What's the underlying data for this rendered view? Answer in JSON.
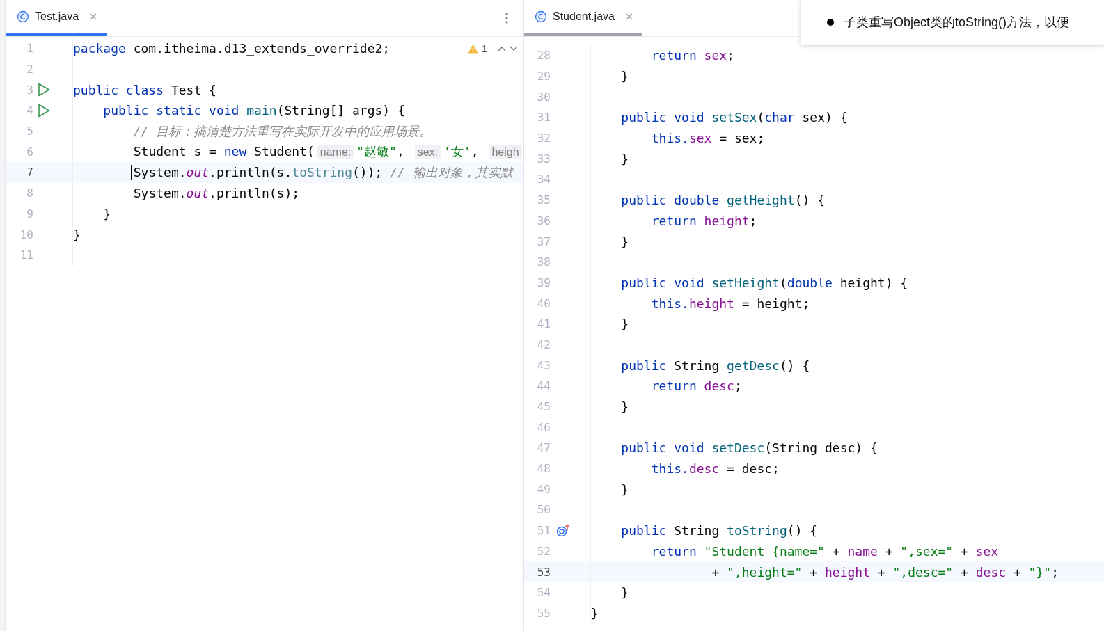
{
  "left_editor": {
    "focused": true,
    "tab": {
      "title": "Test.java",
      "selected": true
    },
    "problems": {
      "count": "1"
    },
    "lines": [
      {
        "number": "1",
        "current": false,
        "kind": "plain",
        "tokens": [
          {
            "kind": "kw",
            "text": "package"
          },
          {
            "kind": "id",
            "text": " com.itheima.d13_extends_override2;"
          }
        ]
      },
      {
        "number": "2",
        "current": false,
        "kind": "plain"
      },
      {
        "number": "3",
        "current": false,
        "kind": "run",
        "tokens": [
          {
            "kind": "kw",
            "text": "public class"
          },
          {
            "kind": "id",
            "text": " Test {"
          }
        ]
      },
      {
        "number": "4",
        "current": false,
        "kind": "run",
        "tokens": [
          {
            "kind": "kw",
            "text": "    public static void "
          },
          {
            "kind": "decl",
            "text": "main"
          },
          {
            "kind": "id",
            "text": "(String[] args) {"
          }
        ]
      },
      {
        "number": "5",
        "current": false,
        "kind": "plain",
        "tokens": [
          {
            "kind": "cmt",
            "text": "        // 目标：搞清楚方法重写在实际开发中的应用场景。"
          }
        ]
      },
      {
        "number": "6",
        "current": false,
        "kind": "plain",
        "tokens": [
          {
            "kind": "id",
            "text": "        Student s = "
          },
          {
            "kind": "kw",
            "text": "new"
          },
          {
            "kind": "id",
            "text": " Student("
          },
          {
            "kind": "hint",
            "text": "name:"
          },
          {
            "kind": "str",
            "text": "\"赵敏\""
          },
          {
            "kind": "id",
            "text": ", "
          },
          {
            "kind": "hint",
            "text": "sex:"
          },
          {
            "kind": "str",
            "text": "'女'"
          },
          {
            "kind": "id",
            "text": ", "
          },
          {
            "kind": "hint",
            "text": "heigh"
          }
        ]
      },
      {
        "number": "7",
        "current": true,
        "kind": "plain",
        "tokens": [
          {
            "kind": "id",
            "text": "        System."
          },
          {
            "kind": "static",
            "text": "out"
          },
          {
            "kind": "id",
            "text": ".println(s."
          },
          {
            "kind": "call",
            "text": "toString"
          },
          {
            "kind": "id",
            "text": "()); "
          },
          {
            "kind": "cmt",
            "text": "// 输出对象，其实默"
          }
        ]
      },
      {
        "number": "8",
        "current": false,
        "kind": "plain",
        "tokens": [
          {
            "kind": "id",
            "text": "        System."
          },
          {
            "kind": "static",
            "text": "out"
          },
          {
            "kind": "id",
            "text": ".println(s);"
          }
        ]
      },
      {
        "number": "9",
        "current": false,
        "kind": "plain",
        "tokens": [
          {
            "kind": "id",
            "text": "    }"
          }
        ]
      },
      {
        "number": "10",
        "current": false,
        "kind": "plain",
        "tokens": [
          {
            "kind": "id",
            "text": "}"
          }
        ]
      },
      {
        "number": "11",
        "current": false,
        "kind": "plain"
      }
    ]
  },
  "right_editor": {
    "focused": false,
    "tab": {
      "title": "Student.java",
      "selected": true
    },
    "lines": [
      {
        "number": "28",
        "current": false,
        "kind": "plain",
        "tokens": [
          {
            "kind": "kw",
            "text": "        return "
          },
          {
            "kind": "field",
            "text": "sex"
          },
          {
            "kind": "id",
            "text": ";"
          }
        ]
      },
      {
        "number": "29",
        "current": false,
        "kind": "plain",
        "tokens": [
          {
            "kind": "id",
            "text": "    }"
          }
        ]
      },
      {
        "number": "30",
        "current": false,
        "kind": "plain"
      },
      {
        "number": "31",
        "current": false,
        "kind": "plain",
        "tokens": [
          {
            "kind": "kw",
            "text": "    public void "
          },
          {
            "kind": "decl",
            "text": "setSex"
          },
          {
            "kind": "id",
            "text": "("
          },
          {
            "kind": "kw",
            "text": "char"
          },
          {
            "kind": "id",
            "text": " sex) {"
          }
        ]
      },
      {
        "number": "32",
        "current": false,
        "kind": "plain",
        "tokens": [
          {
            "kind": "kw",
            "text": "        this."
          },
          {
            "kind": "field",
            "text": "sex"
          },
          {
            "kind": "id",
            "text": " = sex;"
          }
        ]
      },
      {
        "number": "33",
        "current": false,
        "kind": "plain",
        "tokens": [
          {
            "kind": "id",
            "text": "    }"
          }
        ]
      },
      {
        "number": "34",
        "current": false,
        "kind": "plain"
      },
      {
        "number": "35",
        "current": false,
        "kind": "plain",
        "tokens": [
          {
            "kind": "kw",
            "text": "    public double "
          },
          {
            "kind": "decl",
            "text": "getHeight"
          },
          {
            "kind": "id",
            "text": "() {"
          }
        ]
      },
      {
        "number": "36",
        "current": false,
        "kind": "plain",
        "tokens": [
          {
            "kind": "kw",
            "text": "        return "
          },
          {
            "kind": "field",
            "text": "height"
          },
          {
            "kind": "id",
            "text": ";"
          }
        ]
      },
      {
        "number": "37",
        "current": false,
        "kind": "plain",
        "tokens": [
          {
            "kind": "id",
            "text": "    }"
          }
        ]
      },
      {
        "number": "38",
        "current": false,
        "kind": "plain"
      },
      {
        "number": "39",
        "current": false,
        "kind": "plain",
        "tokens": [
          {
            "kind": "kw",
            "text": "    public void "
          },
          {
            "kind": "decl",
            "text": "setHeight"
          },
          {
            "kind": "id",
            "text": "("
          },
          {
            "kind": "kw",
            "text": "double"
          },
          {
            "kind": "id",
            "text": " height) {"
          }
        ]
      },
      {
        "number": "40",
        "current": false,
        "kind": "plain",
        "tokens": [
          {
            "kind": "kw",
            "text": "        this."
          },
          {
            "kind": "field",
            "text": "height"
          },
          {
            "kind": "id",
            "text": " = height;"
          }
        ]
      },
      {
        "number": "41",
        "current": false,
        "kind": "plain",
        "tokens": [
          {
            "kind": "id",
            "text": "    }"
          }
        ]
      },
      {
        "number": "42",
        "current": false,
        "kind": "plain"
      },
      {
        "number": "43",
        "current": false,
        "kind": "plain",
        "tokens": [
          {
            "kind": "kw",
            "text": "    public"
          },
          {
            "kind": "id",
            "text": " String "
          },
          {
            "kind": "decl",
            "text": "getDesc"
          },
          {
            "kind": "id",
            "text": "() {"
          }
        ]
      },
      {
        "number": "44",
        "current": false,
        "kind": "plain",
        "tokens": [
          {
            "kind": "kw",
            "text": "        return "
          },
          {
            "kind": "field",
            "text": "desc"
          },
          {
            "kind": "id",
            "text": ";"
          }
        ]
      },
      {
        "number": "45",
        "current": false,
        "kind": "plain",
        "tokens": [
          {
            "kind": "id",
            "text": "    }"
          }
        ]
      },
      {
        "number": "46",
        "current": false,
        "kind": "plain"
      },
      {
        "number": "47",
        "current": false,
        "kind": "plain",
        "tokens": [
          {
            "kind": "kw",
            "text": "    public void "
          },
          {
            "kind": "decl",
            "text": "setDesc"
          },
          {
            "kind": "id",
            "text": "(String desc) {"
          }
        ]
      },
      {
        "number": "48",
        "current": false,
        "kind": "plain",
        "tokens": [
          {
            "kind": "kw",
            "text": "        this."
          },
          {
            "kind": "field",
            "text": "desc"
          },
          {
            "kind": "id",
            "text": " = desc;"
          }
        ]
      },
      {
        "number": "49",
        "current": false,
        "kind": "plain",
        "tokens": [
          {
            "kind": "id",
            "text": "    }"
          }
        ]
      },
      {
        "number": "50",
        "current": false,
        "kind": "plain"
      },
      {
        "number": "51",
        "current": false,
        "kind": "override",
        "tokens": [
          {
            "kind": "kw",
            "text": "    public"
          },
          {
            "kind": "id",
            "text": " String "
          },
          {
            "kind": "decl",
            "text": "toString"
          },
          {
            "kind": "id",
            "text": "() {"
          }
        ]
      },
      {
        "number": "52",
        "current": false,
        "kind": "plain",
        "tokens": [
          {
            "kind": "kw",
            "text": "        return "
          },
          {
            "kind": "str",
            "text": "\"Student {name=\""
          },
          {
            "kind": "id",
            "text": " + "
          },
          {
            "kind": "field",
            "text": "name"
          },
          {
            "kind": "id",
            "text": " + "
          },
          {
            "kind": "str",
            "text": "\",sex=\""
          },
          {
            "kind": "id",
            "text": " + "
          },
          {
            "kind": "field",
            "text": "sex"
          }
        ]
      },
      {
        "number": "53",
        "current": true,
        "kind": "plain",
        "tokens": [
          {
            "kind": "id",
            "text": "                + "
          },
          {
            "kind": "str",
            "text": "\",height=\""
          },
          {
            "kind": "id",
            "text": " + "
          },
          {
            "kind": "field",
            "text": "height"
          },
          {
            "kind": "id",
            "text": " + "
          },
          {
            "kind": "str",
            "text": "\",desc=\""
          },
          {
            "kind": "id",
            "text": " + "
          },
          {
            "kind": "field",
            "text": "desc"
          },
          {
            "kind": "id",
            "text": " + "
          },
          {
            "kind": "str",
            "text": "\"}\""
          },
          {
            "kind": "id",
            "text": ";"
          }
        ]
      },
      {
        "number": "54",
        "current": false,
        "kind": "plain",
        "tokens": [
          {
            "kind": "id",
            "text": "    }"
          }
        ]
      },
      {
        "number": "55",
        "current": false,
        "kind": "plain",
        "tokens": [
          {
            "kind": "id",
            "text": "}"
          }
        ]
      }
    ]
  },
  "popup": {
    "text": "子类重写Object类的toString()方法，以便"
  }
}
